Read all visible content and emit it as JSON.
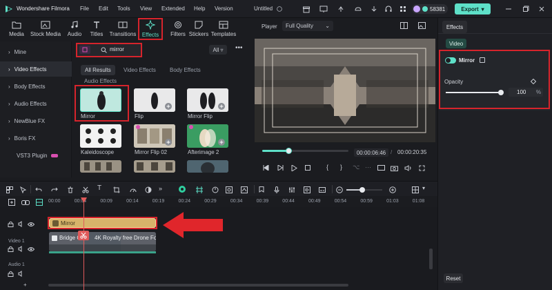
{
  "app": {
    "name": "Wondershare Filmora",
    "menu": [
      "File",
      "Edit",
      "Tools",
      "View",
      "Extended",
      "Help",
      "Version"
    ],
    "project_title": "Untitled",
    "credits": "58381",
    "export_label": "Export"
  },
  "media_tabs": [
    "Media",
    "Stock Media",
    "Audio",
    "Titles",
    "Transitions",
    "Effects",
    "Filters",
    "Stickers",
    "Templates"
  ],
  "sidebar": {
    "items": [
      "Mine",
      "Video Effects",
      "Body Effects",
      "Audio Effects",
      "NewBlue FX",
      "Boris FX",
      "VST3 Plugin"
    ]
  },
  "effects_panel": {
    "search_value": "mirror",
    "filter_label": "All",
    "chips": [
      "All Results",
      "Video Effects",
      "Body Effects"
    ],
    "section_label": "Audio Effects",
    "thumbnails": [
      {
        "label": "Mirror"
      },
      {
        "label": "Flip"
      },
      {
        "label": "Mirror Flip"
      },
      {
        "label": "Kaleidoscope"
      },
      {
        "label": "Mirror Flip 02"
      },
      {
        "label": "Afterimage 2"
      }
    ]
  },
  "player": {
    "label": "Player",
    "quality": "Full Quality",
    "current_time": "00:00:06:46",
    "total_time": "00:00:20:35",
    "progress_fraction": 0.3
  },
  "inspector": {
    "tab": "Effects",
    "subtab": "Video",
    "effect_name": "Mirror",
    "enabled": true,
    "opacity_label": "Opacity",
    "opacity_value": "100",
    "opacity_unit": "%",
    "opacity_fraction": 1.0,
    "reset_label": "Reset"
  },
  "timeline": {
    "ruler_labels": [
      "00:00",
      "00:04",
      "00:09",
      "00:14",
      "00:19",
      "00:24",
      "00:29",
      "00:34",
      "00:39",
      "00:44",
      "00:49",
      "00:54",
      "00:59",
      "01:03",
      "01:08"
    ],
    "effect_clip_label": "Mirror",
    "video_clip_label": "Bridge C",
    "video_clip_label_2": "4K Royalty free Drone Fo",
    "track_video": "Video 1",
    "track_audio": "Audio 1",
    "zoom_fraction": 0.45
  },
  "colors": {
    "accent": "#5ee0c8",
    "highlight": "#d7242c",
    "effect_clip": "#d7b46a",
    "playhead": "#e05a5a"
  }
}
